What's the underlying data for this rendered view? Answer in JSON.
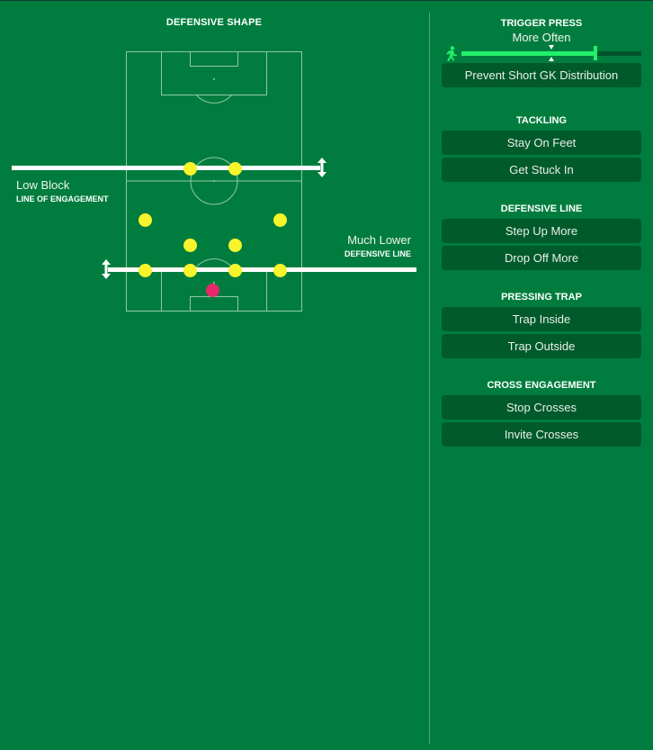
{
  "defensive_shape": {
    "title": "DEFENSIVE SHAPE",
    "line_of_engagement": {
      "value": "Low Block",
      "label": "LINE OF ENGAGEMENT"
    },
    "defensive_line": {
      "value": "Much Lower",
      "label": "DEFENSIVE LINE"
    },
    "formation": {
      "outfield_players": 10,
      "goalkeepers": 1,
      "player_color": "#f7f42b",
      "goalkeeper_color": "#e8276c"
    }
  },
  "trigger_press": {
    "title": "TRIGGER PRESS",
    "value": "More Often",
    "level_fraction": 0.75,
    "default_fraction": 0.5,
    "icon": "running-player-icon",
    "button": "Prevent Short GK Distribution"
  },
  "tackling": {
    "title": "TACKLING",
    "options": [
      "Stay On Feet",
      "Get Stuck In"
    ]
  },
  "defensive_line_panel": {
    "title": "DEFENSIVE LINE",
    "options": [
      "Step Up More",
      "Drop Off More"
    ]
  },
  "pressing_trap": {
    "title": "PRESSING TRAP",
    "options": [
      "Trap Inside",
      "Trap Outside"
    ]
  },
  "cross_engagement": {
    "title": "CROSS ENGAGEMENT",
    "options": [
      "Stop Crosses",
      "Invite Crosses"
    ]
  },
  "colors": {
    "background": "#007d3e",
    "button_bg": "#005a2a",
    "slider_fill": "#22f06a"
  }
}
